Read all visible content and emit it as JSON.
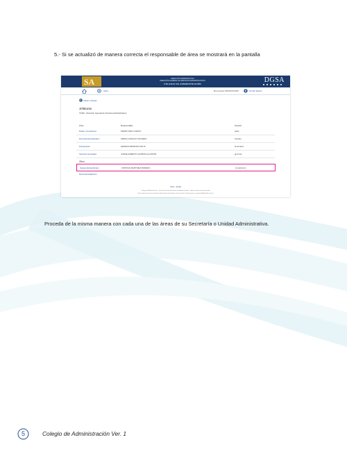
{
  "instructions": {
    "step5": "5.- Si se actualizó de manera correcta el responsable de área se mostrará en la pantalla",
    "closing": "Proceda de la misma manera con cada una de las áreas de su Secretaría o Unidad Administrativa."
  },
  "screenshot": {
    "banner": {
      "line1": "DIRECCIÓN ADMINISTRATIVA",
      "line2": "DIRECCIÓN GENERAL DE SERVICIOS ADMINISTRATIVOS",
      "line3": "COLEGIO DE ADMINISTRACIÓN",
      "brand": "DGSA"
    },
    "nav": {
      "home_label": "Inicio",
      "user_label": "Bienvenido(a): ADMINISTRADOR",
      "logout_label": "Cerrar Sesión"
    },
    "back_label": "Volver a Áreas",
    "section_title": "Jefaturas",
    "section_subtitle": "T4491 - Dirección General de Servicios Administrativos",
    "columns": [
      "Área",
      "Responsable",
      "Usuario"
    ],
    "rows": [
      {
        "area": "Rutas y Comisiones",
        "responsable": "PEDRO DÍAZ LOZANO",
        "usuario": "pdiaz"
      },
      {
        "area": "Personal Administrativo",
        "responsable": "FABIOLA MACIAS TINAJERO",
        "usuario": "fmacias"
      },
      {
        "area": "Presupuesto",
        "responsable": "HERNAN MENDOZA SOLIS",
        "usuario": "hmendoza"
      },
      {
        "area": "Servicios Generales",
        "responsable": "JORGE ALBERTO GUZMAN ALCANTAR",
        "usuario": "jguzman"
      }
    ],
    "group_label": "Otros",
    "highlighted_row": {
      "area": "Ingreso Extraordinario",
      "responsable": "CRISTIAN MARTINEZ MORENO",
      "usuario": "crmartinezm"
    },
    "extra_row": "Personal Académico",
    "footer": {
      "links": "Inicio · Ayuda",
      "line1": "Colegio de Administración · Dirección General de Servicios Administrativos · todos los derechos reservados",
      "line2": "Este sistema es de uso exclusivo del personal autorizado, el mal uso de la información es responsabilidad del usuario"
    }
  },
  "page_footer": {
    "page_number": "5",
    "doc_label": "Colegio de Administración Ver. 1"
  }
}
